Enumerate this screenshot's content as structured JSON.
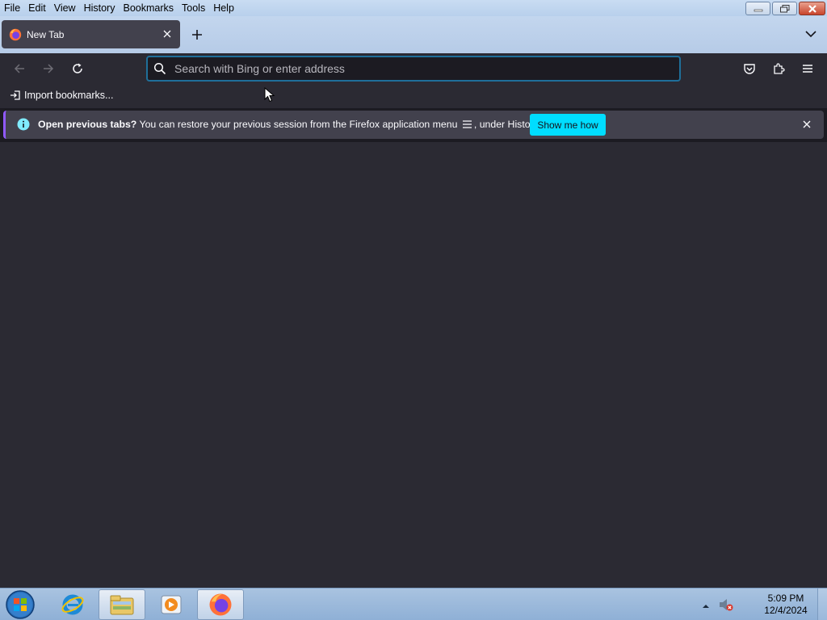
{
  "menubar": {
    "items": [
      "File",
      "Edit",
      "View",
      "History",
      "Bookmarks",
      "Tools",
      "Help"
    ]
  },
  "tab": {
    "title": "New Tab"
  },
  "urlbar": {
    "placeholder": "Search with Bing or enter address",
    "value": ""
  },
  "bookmarks": {
    "import_label": "Import bookmarks..."
  },
  "notification": {
    "bold_text": "Open previous tabs?",
    "text_before_icon": " You can restore your previous session from the Firefox application menu ",
    "text_after_icon": ", under History.",
    "button_label": "Show me how"
  },
  "taskbar": {
    "clock_time": "5:09 PM",
    "clock_date": "12/4/2024"
  },
  "colors": {
    "accent": "#00ddff",
    "toolbar": "#2b2a33",
    "tab": "#42414d",
    "notification_stripe": "#9059ff"
  }
}
